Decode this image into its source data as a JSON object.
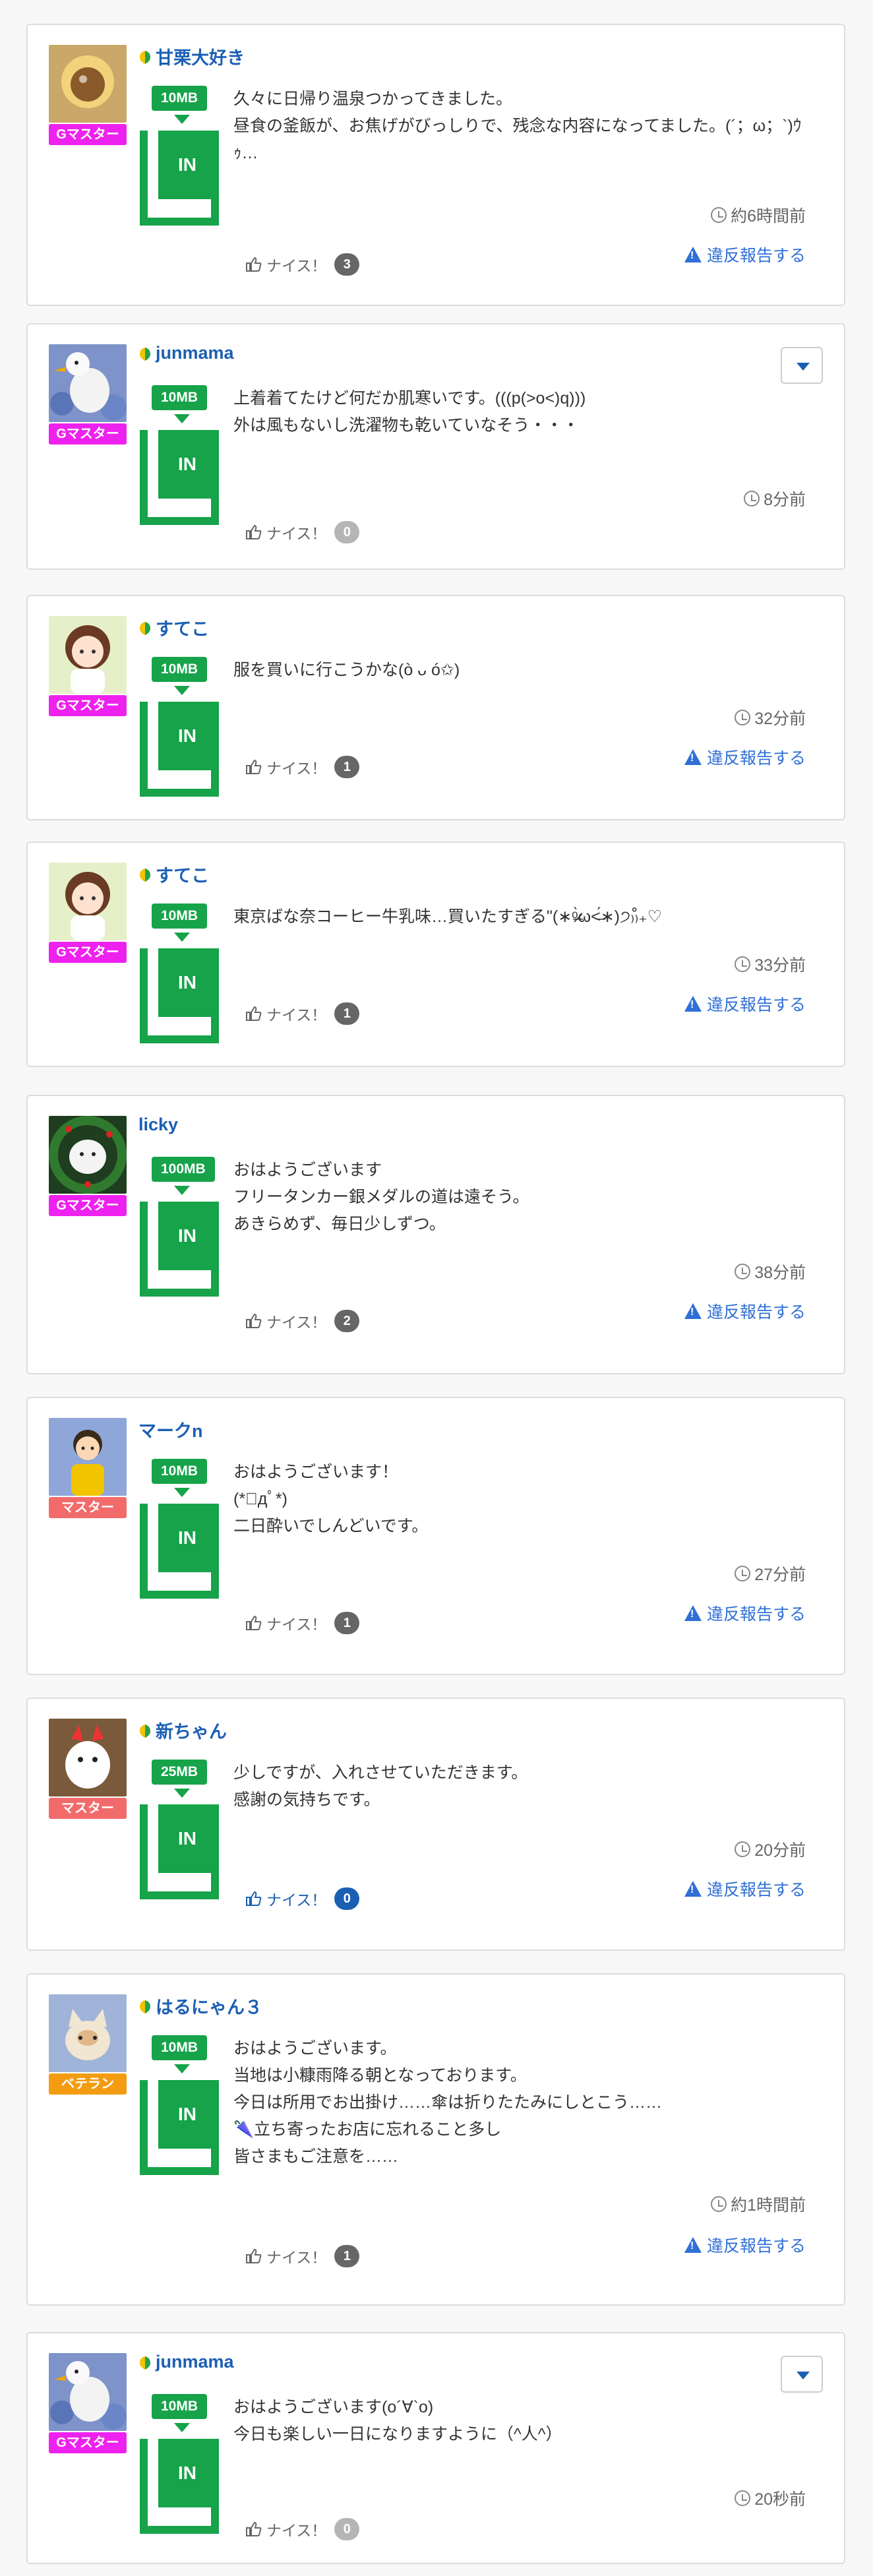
{
  "colors": {
    "brand_green": "#16a34a",
    "link_blue": "#1b5fb3",
    "report_blue": "#2f6fd6",
    "rank_gmaster": "#ee22ee",
    "rank_master": "#f26b6b",
    "rank_veteran": "#f39c12"
  },
  "report_label": "違反報告する",
  "nice_label": "ナイス！",
  "in_label": "IN",
  "posts": [
    {
      "user": "甘栗大好き",
      "beginner": true,
      "rank": "Gマスター",
      "rank_color": "#ee22ee",
      "avatar_icon": "chestnut-avatar",
      "badge": "10MB",
      "lines": [
        "久々に日帰り温泉つかってきました。",
        "昼食の釜飯が、お焦げがびっしりで、残念な内容になってました。(´；ω；`)ｳｩ…"
      ],
      "time": "約6時間前",
      "nice_count": "3",
      "count_style": "dark",
      "nice_active": false,
      "has_report": true,
      "has_dropdown": false
    },
    {
      "user": "junmama",
      "beginner": true,
      "rank": "Gマスター",
      "rank_color": "#ee22ee",
      "avatar_icon": "swan-avatar",
      "badge": "10MB",
      "lines": [
        "上着着てたけど何だか肌寒いです。(((p(>o<)q)))",
        "外は風もないし洗濯物も乾いていなそう・・・"
      ],
      "time": "8分前",
      "nice_count": "0",
      "count_style": "zero",
      "nice_active": false,
      "has_report": false,
      "has_dropdown": true
    },
    {
      "user": "すてこ",
      "beginner": true,
      "rank": "Gマスター",
      "rank_color": "#ee22ee",
      "avatar_icon": "girl-avatar",
      "badge": "10MB",
      "lines": [
        "服を買いに行こうかな(ò ᴗ ó✩)"
      ],
      "time": "32分前",
      "nice_count": "1",
      "count_style": "dark",
      "nice_active": false,
      "has_report": true,
      "has_dropdown": false
    },
    {
      "user": "すてこ",
      "beginner": true,
      "rank": "Gマスター",
      "rank_color": "#ee22ee",
      "avatar_icon": "girl-avatar",
      "badge": "10MB",
      "lines": [
        "東京ばな奈コーヒー牛乳味…買いたすぎる\"(∗ᵒ̶̶̷̀ω˂̶́∗)੭₎₎̊₊♡"
      ],
      "time": "33分前",
      "nice_count": "1",
      "count_style": "dark",
      "nice_active": false,
      "has_report": true,
      "has_dropdown": false
    },
    {
      "user": "licky",
      "beginner": false,
      "rank": "Gマスター",
      "rank_color": "#ee22ee",
      "avatar_icon": "dog-wreath-avatar",
      "badge": "100MB",
      "lines": [
        "おはようございます",
        "フリータンカー銀メダルの道は遠そう。",
        "あきらめず、毎日少しずつ。"
      ],
      "time": "38分前",
      "nice_count": "2",
      "count_style": "dark",
      "nice_active": false,
      "has_report": true,
      "has_dropdown": false
    },
    {
      "user": "マークn",
      "beginner": false,
      "rank": "マスター",
      "rank_color": "#f26b6b",
      "avatar_icon": "boy-avatar",
      "badge": "10MB",
      "lines": [
        "おはようございます！",
        "(*ﾟдﾟ*)",
        "二日酔いでしんどいです。"
      ],
      "time": "27分前",
      "nice_count": "1",
      "count_style": "dark",
      "nice_active": false,
      "has_report": true,
      "has_dropdown": false
    },
    {
      "user": "新ちゃん",
      "beginner": true,
      "rank": "マスター",
      "rank_color": "#f26b6b",
      "avatar_icon": "character-avatar",
      "badge": "25MB",
      "lines": [
        "少しですが、入れさせていただきます。",
        "感謝の気持ちです。"
      ],
      "time": "20分前",
      "nice_count": "0",
      "count_style": "blue",
      "nice_active": true,
      "has_report": true,
      "has_dropdown": false
    },
    {
      "user": "はるにゃん３",
      "beginner": true,
      "rank": "ベテラン",
      "rank_color": "#f39c12",
      "avatar_icon": "cat-avatar",
      "badge": "10MB",
      "lines": [
        "おはようございます。",
        "当地は小糠雨降る朝となっております。",
        "今日は所用でお出掛け……傘は折りたたみにしとこう……",
        "🌂立ち寄ったお店に忘れること多し",
        "皆さまもご注意を……"
      ],
      "time": "約1時間前",
      "nice_count": "1",
      "count_style": "dark",
      "nice_active": false,
      "has_report": true,
      "has_dropdown": false
    },
    {
      "user": "junmama",
      "beginner": true,
      "rank": "Gマスター",
      "rank_color": "#ee22ee",
      "avatar_icon": "swan-avatar",
      "badge": "10MB",
      "lines": [
        "おはようございます(o´∀`o)",
        "今日も楽しい一日になりますように（^人^）"
      ],
      "time": "20秒前",
      "nice_count": "0",
      "count_style": "zero",
      "nice_active": false,
      "has_report": false,
      "has_dropdown": true
    }
  ]
}
